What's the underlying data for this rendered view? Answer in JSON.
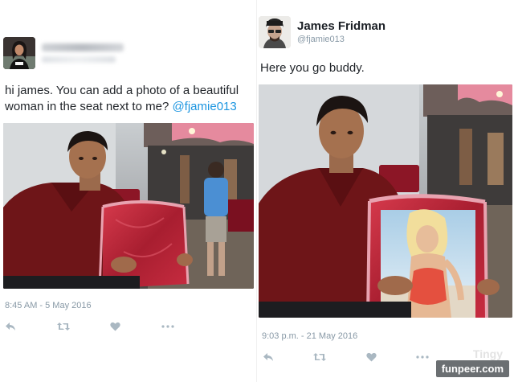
{
  "left_tweet": {
    "text_plain": "hi james. You can add a photo of a beautiful woman in the seat next to me? ",
    "mention": "@fjamie013",
    "timestamp": "8:45 AM - 5 May 2016",
    "icons": [
      "reply-icon",
      "retweet-icon",
      "like-icon",
      "more-icon"
    ]
  },
  "right_tweet": {
    "name": "James Fridman",
    "handle": "@fjamie013",
    "text": "Here you go buddy.",
    "timestamp": "9:03 p.m. - 21 May 2016",
    "icons": [
      "reply-icon",
      "retweet-icon",
      "like-icon",
      "more-icon"
    ]
  },
  "watermark": {
    "faint": "Tingy",
    "label": "funpeer.com"
  },
  "colors": {
    "link": "#1b95e0",
    "meta": "#8899a6",
    "icon": "#aab8c2"
  }
}
